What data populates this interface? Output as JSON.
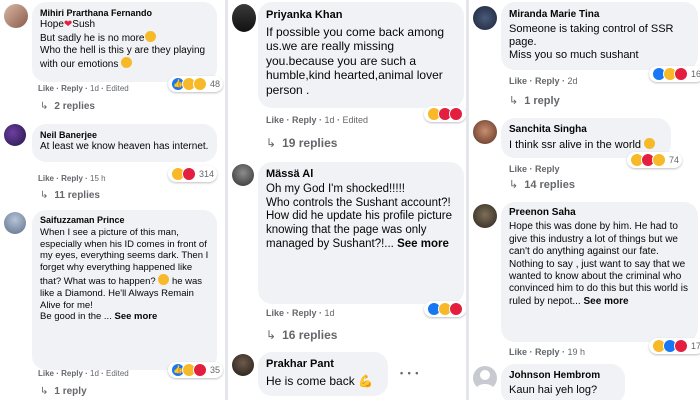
{
  "ui": {
    "like": "Like",
    "reply": "Reply"
  },
  "col1": [
    {
      "name": "Mihiri Prarthana Fernando",
      "text_a": "Hope",
      "text_b": "Sush\nBut sadly he is no more",
      "text_c": "\nWho the hell is this y are they playing with our emotions",
      "time": "1d",
      "edited": "Edited",
      "count": "48",
      "replies": "2 replies"
    },
    {
      "name": "Neil Banerjee",
      "text": "At least we know heaven has internet.",
      "time": "15 h",
      "count": "314",
      "replies": "11 replies"
    },
    {
      "name": "Saifuzzaman Prince",
      "text_a": "When I see a picture of this man, especially when his ID comes in front of my eyes, everything seems dark. Then I forget why everything happened like that? What was to happen?",
      "text_b": " he was like a Diamond. He'll Always Remain Alive for me!",
      "text_c": "\nBe good in the ... ",
      "see_more": "See more",
      "time": "1d",
      "edited": "Edited",
      "count": "35",
      "replies": "1 reply"
    }
  ],
  "col2": [
    {
      "name": "Priyanka Khan",
      "text": "If possible you come back among us.we are really missing you.because you are such a humble,kind hearted,animal lover person .",
      "time": "1d",
      "edited": "Edited",
      "replies": "19 replies"
    },
    {
      "name": "Mässä Al",
      "text": "Oh my God I'm shocked!!!!!\nWho controls the Sushant account?!\nHow did he update his profile picture knowing that the page was only managed by Sushant?!... ",
      "see_more": "See more",
      "time": "1d",
      "replies": "16 replies"
    },
    {
      "name": "Prakhar Pant",
      "text": "He is come back ",
      "dots": "• • •"
    }
  ],
  "col3": [
    {
      "name": "Miranda Marie Tina",
      "text": "Someone is taking control of SSR page.\nMiss you so much sushant",
      "time": "2d",
      "count": "16",
      "replies": "1 reply"
    },
    {
      "name": "Sanchita Singha",
      "text": "I think ssr alive in the world ",
      "count": "74",
      "replies": "14 replies"
    },
    {
      "name": "Preenon Saha",
      "text": "Hope this was done by him. He had to give this industry a lot of things but we can't do anything against our fate. Nothing to say , just want to say that we wanted to know about the criminal who convinced him to do this but this world is ruled by nepot... ",
      "see_more": "See more",
      "time": "19 h",
      "count": "17"
    },
    {
      "name": "Johnson Hembrom",
      "text": "Kaun hai yeh log?"
    }
  ],
  "colors": {
    "like": "#1877f2",
    "love": "#e41e3f",
    "haha": "#f7b928",
    "bubble": "#f0f2f5",
    "meta": "#65676b"
  },
  "icons": [
    "like-icon",
    "love-icon",
    "haha-icon",
    "sad-icon",
    "reply-arrow-icon",
    "heart-icon",
    "crying-emoji-icon",
    "sad-emoji-icon",
    "flexed-biceps-icon",
    "ellipsis-icon"
  ]
}
